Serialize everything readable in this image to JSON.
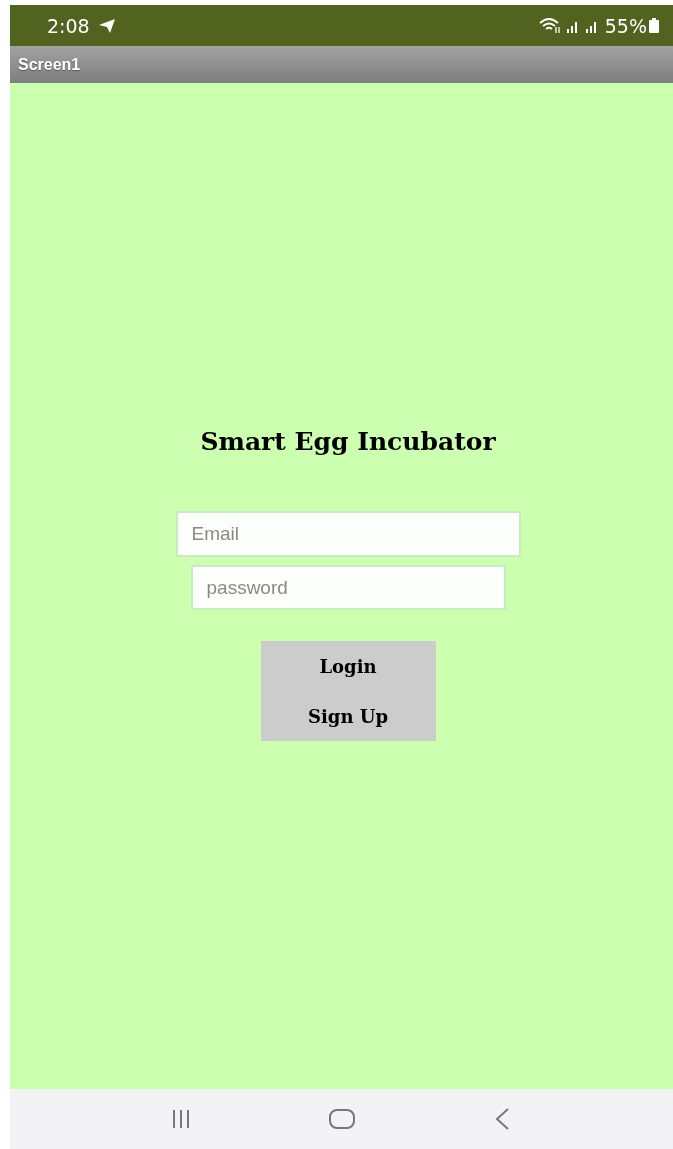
{
  "status_bar": {
    "time": "2:08",
    "battery": "55%"
  },
  "title_bar": {
    "title": "Screen1"
  },
  "heading": "Smart Egg Incubator",
  "fields": [
    {
      "placeholder": "Email",
      "kind": "wide"
    },
    {
      "placeholder": "password",
      "kind": "narrow"
    }
  ],
  "buttons": [
    "Login",
    "Sign Up"
  ]
}
